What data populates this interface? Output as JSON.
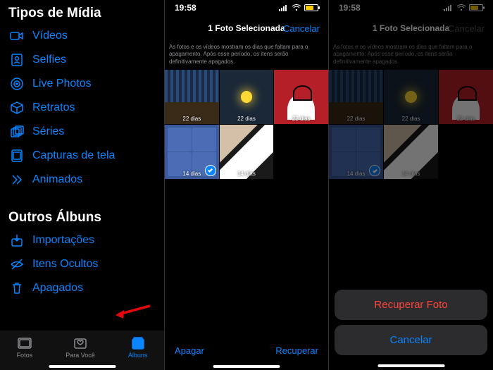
{
  "pane1": {
    "section1_title": "Tipos de Mídia",
    "media_items": [
      {
        "icon": "video-icon",
        "label": "Vídeos"
      },
      {
        "icon": "selfie-icon",
        "label": "Selfies"
      },
      {
        "icon": "live-icon",
        "label": "Live Photos"
      },
      {
        "icon": "portrait-icon",
        "label": "Retratos"
      },
      {
        "icon": "burst-icon",
        "label": "Séries"
      },
      {
        "icon": "screenshot-icon",
        "label": "Capturas de tela"
      },
      {
        "icon": "animated-icon",
        "label": "Animados"
      }
    ],
    "section2_title": "Outros Álbuns",
    "other_items": [
      {
        "icon": "import-icon",
        "label": "Importações"
      },
      {
        "icon": "hidden-icon",
        "label": "Itens Ocultos"
      },
      {
        "icon": "trash-icon",
        "label": "Apagados"
      }
    ],
    "tabs": [
      {
        "label": "Fotos"
      },
      {
        "label": "Para Você"
      },
      {
        "label": "Álbuns"
      }
    ]
  },
  "pane2": {
    "time": "19:58",
    "title": "1 Foto Selecionada",
    "cancel": "Cancelar",
    "info": "As fotos e os vídeos mostram os dias que faltam para o apagamento. Após esse período, os itens serão definitivamente apagados.",
    "thumbs": [
      {
        "kind": "strip",
        "days": "22 dias"
      },
      {
        "kind": "moon",
        "days": "22 dias"
      },
      {
        "kind": "red",
        "days": "22 dias"
      },
      {
        "kind": "blue",
        "days": "14 dias",
        "selected": true
      },
      {
        "kind": "shirt",
        "days": "14 dias"
      }
    ],
    "delete": "Apagar",
    "recover": "Recuperar"
  },
  "pane3": {
    "time": "19:58",
    "title": "1 Foto Selecionada",
    "cancel": "Cancelar",
    "info": "As fotos e os vídeos mostram os dias que faltam para o apagamento. Após esse período, os itens serão definitivamente apagados.",
    "thumbs": [
      {
        "kind": "strip",
        "days": "22 dias"
      },
      {
        "kind": "moon",
        "days": "22 dias"
      },
      {
        "kind": "red",
        "days": "22 dias"
      },
      {
        "kind": "blue",
        "days": "14 dias",
        "selected": true
      },
      {
        "kind": "shirt",
        "days": "14 dias"
      }
    ],
    "sheet": {
      "recover": "Recuperar Foto",
      "cancel": "Cancelar"
    }
  }
}
